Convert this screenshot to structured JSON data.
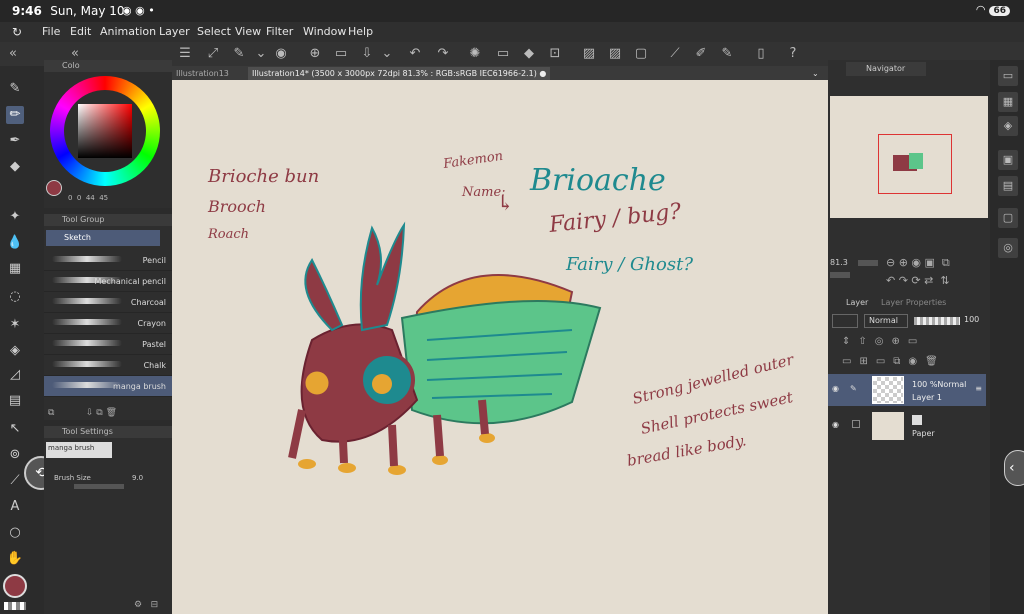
{
  "status": {
    "time": "9:46",
    "date": "Sun, May 10",
    "battery": "66"
  },
  "menu": [
    "File",
    "Edit",
    "Animation",
    "Layer",
    "Select",
    "View",
    "Filter",
    "Window",
    "Help"
  ],
  "tabs": [
    {
      "label": "Illustration13",
      "active": false
    },
    {
      "label": "Illustration14* (3500 x 3000px 72dpi 81.3% : RGB:sRGB IEC61966-2.1)",
      "active": true
    }
  ],
  "color_panel": {
    "title": "Colo",
    "values": [
      "0",
      "0",
      "44",
      "45"
    ],
    "main_color": "#8e3a44"
  },
  "tool_group": {
    "title": "Tool Group",
    "selected": "Sketch"
  },
  "brushes": [
    "Pencil",
    "Mechanical pencil",
    "Charcoal",
    "Crayon",
    "Pastel",
    "Chalk",
    "manga brush"
  ],
  "tool_settings": {
    "title": "Tool Settings",
    "preset": "manga brush",
    "brush_size_label": "Brush Size",
    "brush_size": "9.0"
  },
  "navigator": {
    "title": "Navigator",
    "zoom": "81.3"
  },
  "layer_panel": {
    "tabs": [
      "Layer",
      "Layer Properties"
    ],
    "blend_mode": "Normal",
    "opacity": "100",
    "layers": [
      {
        "name": "Layer 1",
        "info": "100 %Normal",
        "selected": true
      },
      {
        "name": "Paper",
        "info": "",
        "selected": false
      }
    ]
  },
  "canvas_text": {
    "left1": "Brioche bun",
    "left2": "Brooch",
    "left3": "Roach",
    "fakemon": "Fakemon",
    "name": "Name:",
    "arrow": "↳",
    "title": "Brioache",
    "type1": "Fairy / bug?",
    "type2": "Fairy / Ghost?",
    "desc1": "Strong jewelled outer",
    "desc2": "Shell protects sweet",
    "desc3": "bread like body."
  }
}
